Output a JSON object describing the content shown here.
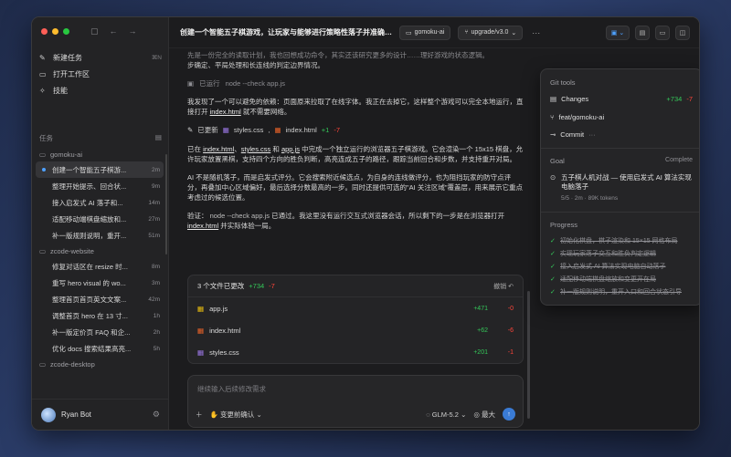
{
  "sidebar": {
    "menu": [
      {
        "label": "新建任务",
        "icon": "edit-icon",
        "kbd": "⌘N"
      },
      {
        "label": "打开工作区",
        "icon": "folder-icon",
        "kbd": ""
      },
      {
        "label": "技能",
        "icon": "sparkle-icon",
        "kbd": ""
      }
    ],
    "tasks_heading": "任务",
    "groups": [
      {
        "project": "gomoku-ai",
        "tasks": [
          {
            "title": "创建一个智能五子棋游...",
            "time": "2m",
            "active": true
          },
          {
            "title": "整理开始提示、回合状...",
            "time": "9m"
          },
          {
            "title": "接入启发式 AI 落子和...",
            "time": "14m"
          },
          {
            "title": "适配移动端棋盘缩放和...",
            "time": "27m"
          },
          {
            "title": "补一版规则说明，重开...",
            "time": "51m"
          }
        ]
      },
      {
        "project": "zcode-website",
        "tasks": [
          {
            "title": "修复对话区在 resize 时...",
            "time": "8m"
          },
          {
            "title": "重写 hero visual 的 wo...",
            "time": "3m"
          },
          {
            "title": "整理首页首页英文文案...",
            "time": "42m"
          },
          {
            "title": "调整首页 hero 在 13 寸...",
            "time": "1h"
          },
          {
            "title": "补一版定价页 FAQ 和企...",
            "time": "2h"
          },
          {
            "title": "优化 docs 搜索结果高亮...",
            "time": "5h"
          }
        ]
      },
      {
        "project": "zcode-desktop",
        "tasks": []
      }
    ],
    "user": {
      "name": "Ryan Bot"
    }
  },
  "header": {
    "title": "创建一个智能五子棋游戏，让玩家与能够进行策略性落子并准确判...",
    "project_chip": "gomoku-ai",
    "branch_chip": "upgrade/v3.0",
    "more": "···"
  },
  "conversation": {
    "faded_line": "先是一份完全的读取计划，我也回想成功命令，其实还该研究更多的设计……理好游戏的状态逻辑。",
    "faded_line2": "步确定、平局处理和长连线的判定边界情况。",
    "command_label": "已运行",
    "command": "node --check app.js",
    "para1": "我发现了一个可以避免的依赖：页面原来拉取了在线字体。我正在去掉它，这样整个游戏可以完全本地运行，直接打开",
    "para1_file": "index.html",
    "para1_tail": "就不需要网络。",
    "edited_label": "已更新",
    "edited_file1": "styles.css",
    "edited_sep": ",",
    "edited_file2": "index.html",
    "edited_plus": "+1",
    "edited_minus": "-7",
    "para2_a": "已在",
    "para2_f1": "index.html",
    "para2_c1": "、",
    "para2_f2": "styles.css",
    "para2_c2": " 和 ",
    "para2_f3": "app.js",
    "para2_b": "中完成一个独立运行的浏览器五子棋游戏。它会渲染一个 15x15 棋盘，允许玩家放置黑棋，支持四个方向的胜负判断，高亮连成五子的路径，跟踪当前回合和步数，并支持重开对局。",
    "para3": "AI 不是随机落子，而是启发式评分。它会搜索附近候选点，为自身的连线做评分，也为阻挡玩家的防守点评分，再叠加中心区域偏好，最后选择分数最高的一步。同时还提供可选的\"AI 关注区域\"覆盖层，用来展示它重点考虑过的候选位置。",
    "para4_a": "验证：",
    "para4_cmd": "node --check app.js",
    "para4_b": "已通过。我这里没有运行交互式浏览器会话，所以剩下的一步是在浏览器打开",
    "para4_f": "index.html",
    "para4_c": "并实际体验一局。"
  },
  "changes": {
    "summary": "3 个文件已更改",
    "plus": "+734",
    "minus": "-7",
    "undo": "撤销",
    "files": [
      {
        "name": "app.js",
        "icon": "js-file-icon",
        "plus": "+471",
        "minus": "-0"
      },
      {
        "name": "index.html",
        "icon": "html-file-icon",
        "plus": "+62",
        "minus": "-6"
      },
      {
        "name": "styles.css",
        "icon": "css-file-icon",
        "plus": "+201",
        "minus": "-1"
      }
    ]
  },
  "composer": {
    "placeholder": "继续输入后续修改需求",
    "mode": "变更前确认",
    "model": "GLM-5.2",
    "effort": "最大"
  },
  "git_panel": {
    "title": "Git tools",
    "changes_label": "Changes",
    "changes_plus": "+734",
    "changes_minus": "-7",
    "branch": "feat/gomoku-ai",
    "commit_label": "Commit",
    "commit_more": "···",
    "goal_heading": "Goal",
    "goal_status": "Complete",
    "goal_text": "五子棋人机对战 — 使用启发式 AI 算法实现电脑落子",
    "goal_meta": "5/5 · 2m · 89K tokens",
    "progress_heading": "Progress",
    "progress": [
      "初始化棋盘，棋子渲染和 15×15 网格布局",
      "实现玩家落子交互和胜负判定逻辑",
      "接入启发式 AI 算法实现电脑自动落子",
      "适配移动端棋盘缩放和变更开在局",
      "补一版规则说明，重开入口和回合状态引导"
    ]
  },
  "colors": {
    "accent": "#4ea1ff",
    "plus": "#34c759",
    "minus": "#ff453a"
  }
}
